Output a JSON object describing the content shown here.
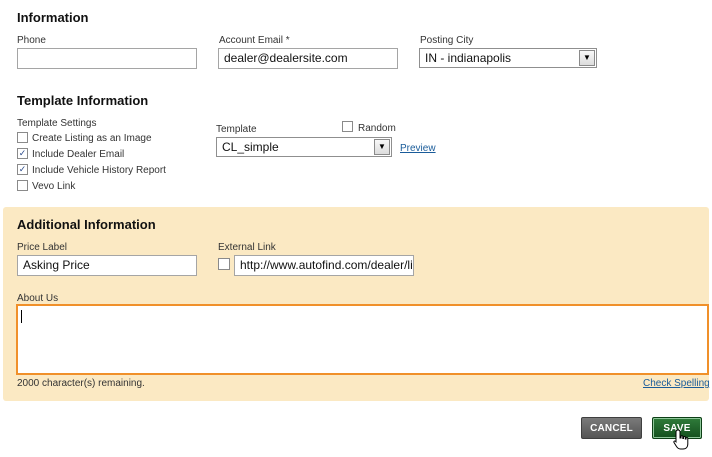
{
  "information": {
    "heading": "Information",
    "phone": {
      "label": "Phone",
      "value": ""
    },
    "account_email": {
      "label": "Account Email *",
      "value": "dealer@dealersite.com"
    },
    "posting_city": {
      "label": "Posting City",
      "value": "IN - indianapolis"
    }
  },
  "template_information": {
    "heading": "Template Information",
    "settings_label": "Template Settings",
    "settings": [
      {
        "label": "Create Listing as an Image",
        "checked": false
      },
      {
        "label": "Include Dealer Email",
        "checked": true
      },
      {
        "label": "Include Vehicle History Report",
        "checked": true
      },
      {
        "label": "Vevo Link",
        "checked": false
      }
    ],
    "template": {
      "label": "Template",
      "value": "CL_simple"
    },
    "random": {
      "label": "Random",
      "checked": false
    },
    "preview_link": "Preview"
  },
  "additional_information": {
    "heading": "Additional Information",
    "price_label": {
      "label": "Price Label",
      "value": "Asking Price"
    },
    "external_link": {
      "label": "External Link",
      "checked": false,
      "value": "http://www.autofind.com/dealer/list"
    },
    "about_us": {
      "label": "About Us",
      "value": ""
    },
    "chars_remaining": "2000 character(s) remaining.",
    "check_spelling_link": "Check Spelling"
  },
  "actions": {
    "cancel_label": "CANCEL",
    "save_label": "SAVE"
  },
  "icons": {
    "check": "✓",
    "dropdown": "▼",
    "cursor": "hand-pointer-icon"
  },
  "colors": {
    "panel_bg": "#fbe9c3",
    "focus_border": "#f0902a",
    "save_green": "#1e6a2a",
    "cancel_gray": "#666666",
    "link_blue": "#1a5c9a"
  }
}
